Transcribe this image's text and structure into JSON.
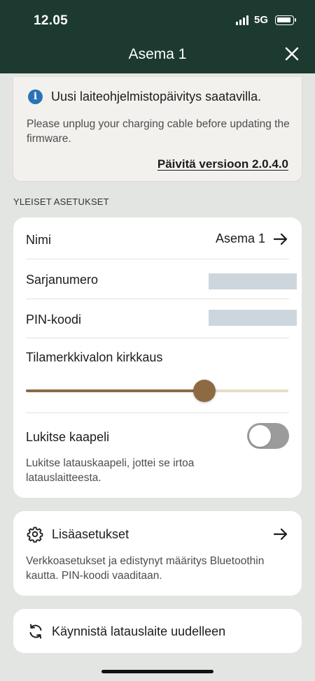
{
  "status_bar": {
    "time": "12.05",
    "network": "5G"
  },
  "header": {
    "title": "Asema 1"
  },
  "banner": {
    "title": "Uusi laiteohjelmistopäivitys saatavilla.",
    "message": "Please unplug your charging cable before updating the firmware.",
    "link_label": "Päivitä versioon 2.0.4.0"
  },
  "section": {
    "label": "YLEISET ASETUKSET"
  },
  "settings": {
    "name_label": "Nimi",
    "name_value": "Asema 1",
    "serial_label": "Sarjanumero",
    "pin_label": "PIN-koodi",
    "brightness_label": "Tilamerkkivalon kirkkaus",
    "brightness_level_percent": 68,
    "lock_label": "Lukitse kaapeli",
    "lock_enabled": false,
    "lock_description": "Lukitse latauskaapeli, jottei se irtoa latauslaitteesta."
  },
  "advanced": {
    "label": "Lisäasetukset",
    "description": "Verkkoasetukset ja edistynyt määritys Bluetoothin kautta. PIN-koodi vaaditaan."
  },
  "restart": {
    "label": "Käynnistä latauslaite uudelleen"
  },
  "colors": {
    "header_bg": "#1c3a30",
    "accent_brown": "#8e6a43",
    "info_blue": "#2b73b5",
    "toggle_off": "#9b9b9b"
  }
}
